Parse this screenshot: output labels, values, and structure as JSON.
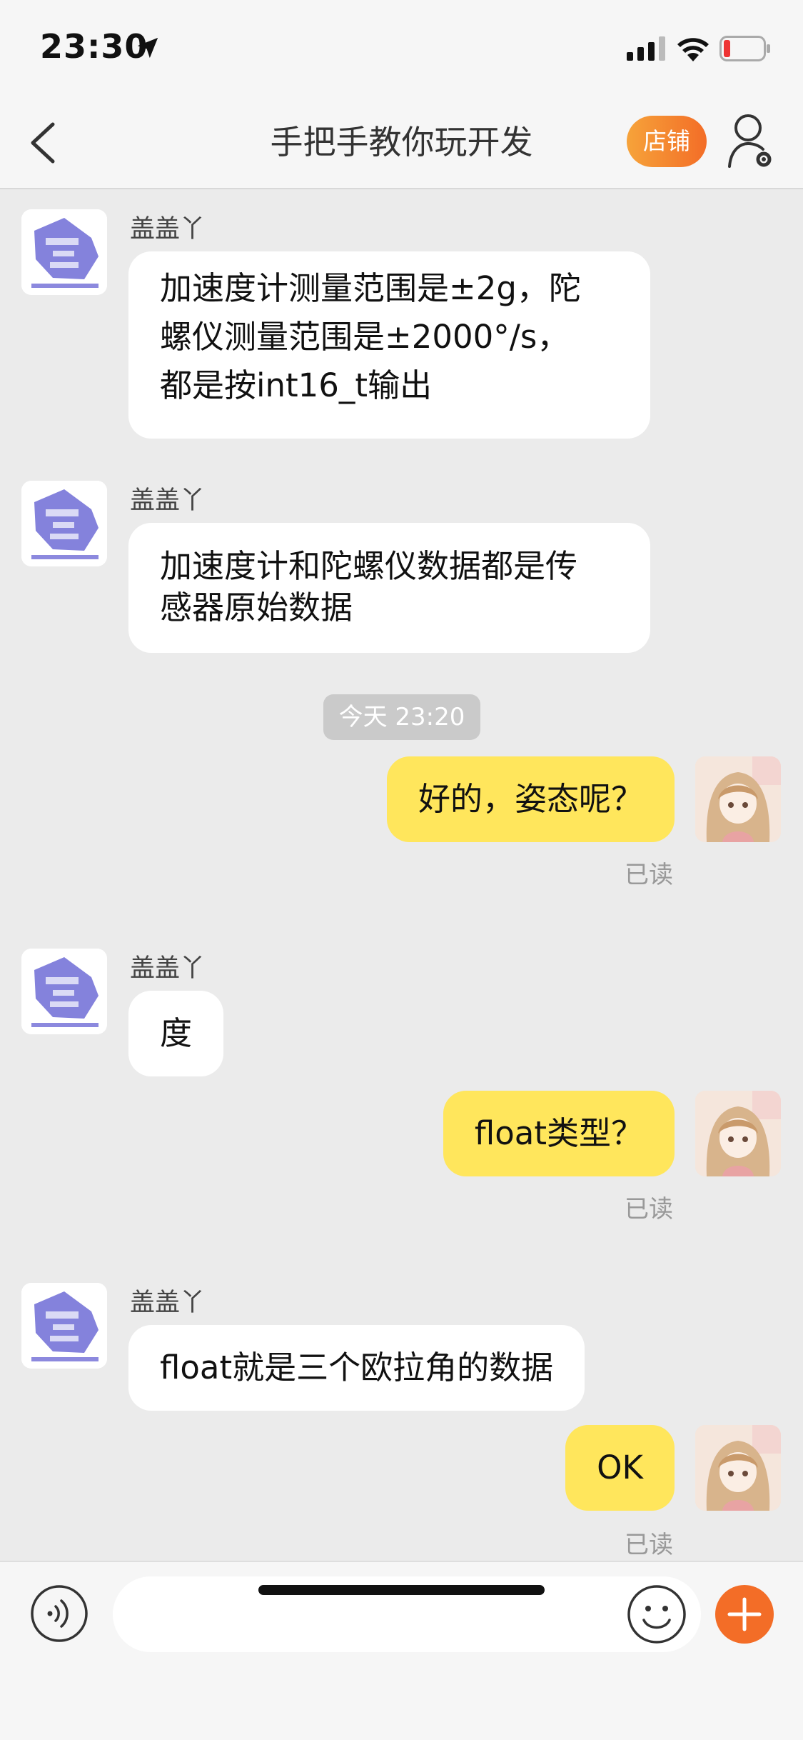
{
  "status_bar": {
    "time": "23:30"
  },
  "nav": {
    "title": "手把手教你玩开发",
    "shop_button": "店铺"
  },
  "messages": [
    {
      "sender": "盖盖丫",
      "lines": [
        "加速度计测量范围是±2g，陀",
        "螺仪测量范围是±2000°/s，",
        "都是按int16_t输出"
      ]
    },
    {
      "sender": "盖盖丫",
      "lines": [
        "加速度计和陀螺仪数据都是传",
        "感器原始数据"
      ]
    },
    {
      "time": "今天 23:20"
    },
    {
      "text": "好的，姿态呢？",
      "read": "已读"
    },
    {
      "sender": "盖盖丫",
      "text": "度"
    },
    {
      "text": "float类型？",
      "read": "已读"
    },
    {
      "sender": "盖盖丫",
      "text": "float就是三个欧拉角的数据"
    },
    {
      "text": "OK",
      "read": "已读"
    }
  ],
  "colors": {
    "accent_orange": "#f36d27",
    "outgoing_bubble": "#ffe65c",
    "incoming_bubble": "#ffffff",
    "chat_background": "#ebebeb"
  }
}
